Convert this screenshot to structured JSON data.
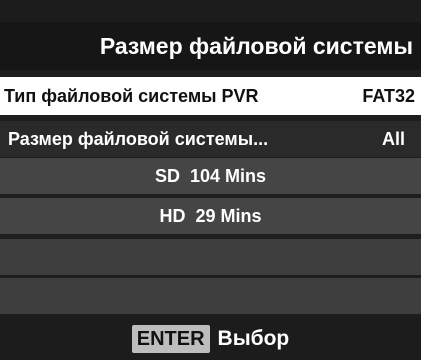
{
  "menu": {
    "title": "Размер файловой системы",
    "rows": {
      "fs_type": {
        "label": "Тип файловой системы PVR",
        "value": "FAT32"
      },
      "fs_size": {
        "label": "Размер файловой системы...",
        "value": "All"
      },
      "sd": {
        "text": "SD  104 Mins"
      },
      "hd": {
        "text": "HD  29 Mins"
      }
    }
  },
  "footer": {
    "key": "ENTER",
    "action": "Выбор"
  },
  "colors": {
    "background": "#1e1e1e",
    "selected_row": "#ffffff",
    "row_gray": "#454545",
    "key_badge": "#bdbdbd"
  }
}
